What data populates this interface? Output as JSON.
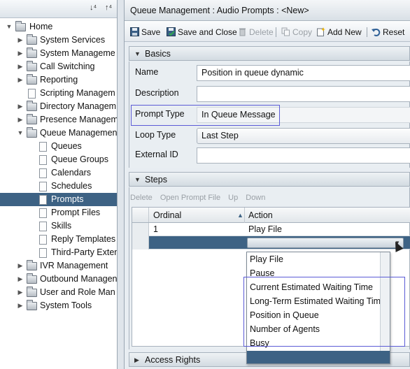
{
  "tree": {
    "toolbar_icons": [
      "expand-icon",
      "collapse-icon"
    ],
    "root": "Home",
    "items": [
      {
        "label": "System Services",
        "type": "folder",
        "expanded": false
      },
      {
        "label": "System Manageme",
        "type": "folder",
        "expanded": false
      },
      {
        "label": "Call Switching",
        "type": "folder",
        "expanded": false
      },
      {
        "label": "Reporting",
        "type": "folder",
        "expanded": false
      },
      {
        "label": "Scripting Managem",
        "type": "page"
      },
      {
        "label": "Directory Managem",
        "type": "folder",
        "expanded": false
      },
      {
        "label": "Presence Managem",
        "type": "folder",
        "expanded": false
      },
      {
        "label": "Queue Managemen",
        "type": "folder",
        "expanded": true
      },
      {
        "label": "Queues",
        "type": "page",
        "child": true
      },
      {
        "label": "Queue Groups",
        "type": "page",
        "child": true
      },
      {
        "label": "Calendars",
        "type": "page",
        "child": true
      },
      {
        "label": "Schedules",
        "type": "page",
        "child": true
      },
      {
        "label": "Prompts",
        "type": "page",
        "child": true,
        "selected": true
      },
      {
        "label": "Prompt Files",
        "type": "page",
        "child": true
      },
      {
        "label": "Skills",
        "type": "page",
        "child": true
      },
      {
        "label": "Reply Templates",
        "type": "page",
        "child": true
      },
      {
        "label": "Third-Party Exten",
        "type": "page",
        "child": true
      },
      {
        "label": "IVR Management",
        "type": "folder",
        "expanded": false
      },
      {
        "label": "Outbound Managen",
        "type": "folder",
        "expanded": false
      },
      {
        "label": "User and Role Man",
        "type": "folder",
        "expanded": false
      },
      {
        "label": "System Tools",
        "type": "folder",
        "expanded": false
      }
    ]
  },
  "title": "Queue Management : Audio Prompts : <New>",
  "actions": {
    "save": "Save",
    "save_close": "Save and Close",
    "delete": "Delete",
    "copy": "Copy",
    "add_new": "Add New",
    "reset": "Reset"
  },
  "basics": {
    "header": "Basics",
    "name_label": "Name",
    "name_value": "Position in queue dynamic",
    "description_label": "Description",
    "description_value": "",
    "prompt_type_label": "Prompt Type",
    "prompt_type_value": "In Queue Message",
    "loop_type_label": "Loop Type",
    "loop_type_value": "Last Step",
    "external_id_label": "External ID",
    "external_id_value": ""
  },
  "steps": {
    "header": "Steps",
    "tools": [
      "Delete",
      "Open Prompt File",
      "Up",
      "Down"
    ],
    "columns": [
      "Ordinal",
      "Action"
    ],
    "rows": [
      {
        "ordinal": "1",
        "action": "Play File"
      }
    ]
  },
  "dropdown_options": [
    "Play File",
    "Pause",
    "Current Estimated Waiting Time",
    "Long-Term Estimated Waiting Time",
    "Position in Queue",
    "Number of Agents",
    "Busy"
  ],
  "access_rights": {
    "header": "Access Rights"
  },
  "colors": {
    "selection": "#3d6284",
    "highlight_box": "#5b5bd6"
  }
}
